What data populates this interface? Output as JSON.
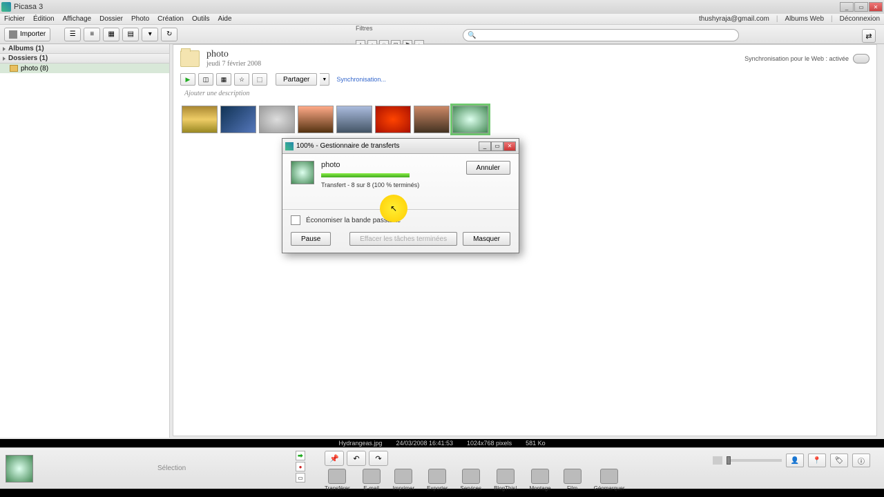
{
  "window": {
    "title": "Picasa 3"
  },
  "menu": {
    "items": [
      "Fichier",
      "Édition",
      "Affichage",
      "Dossier",
      "Photo",
      "Création",
      "Outils",
      "Aide"
    ],
    "right": {
      "email": "thushyraja@gmail.com",
      "webalbums": "Albums Web",
      "logout": "Déconnexion"
    }
  },
  "toolbar": {
    "import": "Importer",
    "filters_label": "Filtres"
  },
  "sidebar": {
    "albums": {
      "label": "Albums (1)"
    },
    "folders": {
      "label": "Dossiers (1)"
    },
    "items": [
      {
        "label": "photo (8)"
      }
    ]
  },
  "folder": {
    "name": "photo",
    "date": "jeudi 7 février 2008",
    "sync_status": "Synchronisation pour le Web : activée",
    "share": "Partager",
    "sync_link": "Synchronisation...",
    "description_placeholder": "Ajouter une description"
  },
  "dialog": {
    "title": "100% - Gestionnaire de transferts",
    "item_name": "photo",
    "progress_pct": 100,
    "progress_text": "Transfert - 8 sur 8 (100 % terminés)",
    "cancel": "Annuler",
    "bandwidth": "Économiser la bande passante",
    "pause": "Pause",
    "clear": "Effacer les tâches terminées",
    "hide": "Masquer"
  },
  "status": {
    "filename": "Hydrangeas.jpg",
    "datetime": "24/03/2008 16:41:53",
    "dimensions": "1024x768 pixels",
    "size": "581 Ko"
  },
  "tray": {
    "selection": "Sélection",
    "actions": [
      {
        "label": "Transférer",
        "cls": "a-transfer"
      },
      {
        "label": "E-mail",
        "cls": "a-email"
      },
      {
        "label": "Imprimer",
        "cls": "a-print"
      },
      {
        "label": "Exporter",
        "cls": "a-export"
      },
      {
        "label": "Services",
        "cls": "a-services"
      },
      {
        "label": "BlogThis!",
        "cls": "a-blog"
      },
      {
        "label": "Montage",
        "cls": "a-montage"
      },
      {
        "label": "Film",
        "cls": "a-film"
      },
      {
        "label": "Géomarquer",
        "cls": "a-geo"
      }
    ]
  }
}
